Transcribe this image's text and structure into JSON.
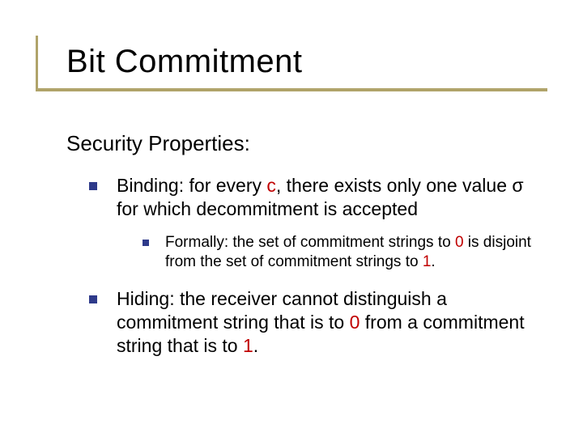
{
  "title": "Bit Commitment",
  "subhead": "Security Properties:",
  "items": [
    {
      "lead": "Binding:",
      "txt1": " for every ",
      "c": "c",
      "txt2": ", there exists only one value σ for which decommitment is accepted",
      "sub": {
        "txt1": "Formally: the set of commitment strings to ",
        "z": "0",
        "txt2": " is disjoint from the set of commitment strings to ",
        "o": "1",
        "txt3": "."
      }
    },
    {
      "lead": "Hiding:",
      "txt1": " the receiver cannot distinguish a commitment string that is to ",
      "z": "0",
      "txt2": " from a commitment string that is to ",
      "o": "1",
      "txt3": "."
    }
  ]
}
